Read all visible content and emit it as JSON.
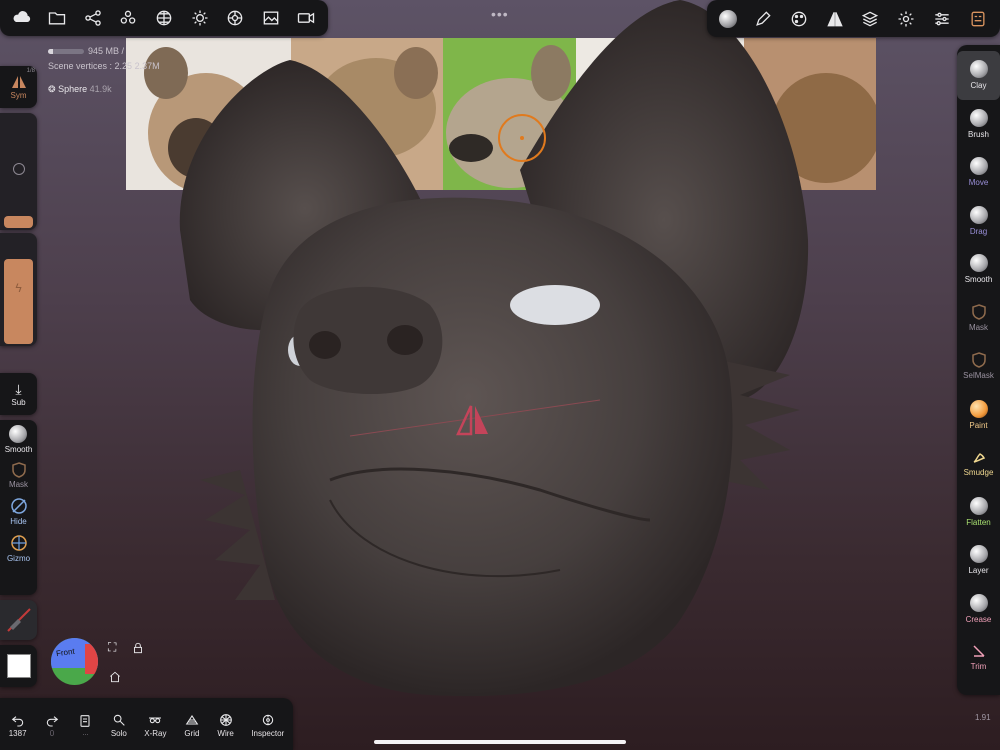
{
  "topbar_left": {
    "icons": [
      "cloud-icon",
      "folder-icon",
      "scene-tree-icon",
      "layers-tree-icon",
      "sphere-grid-icon",
      "sun-icon",
      "material-icon",
      "image-icon",
      "camera-icon"
    ]
  },
  "topbar_right": {
    "icons": [
      "brush-material-icon",
      "pen-icon",
      "palette-icon",
      "symmetry-icon",
      "stack-icon",
      "settings-icon",
      "sliders-icon",
      "app-icon"
    ]
  },
  "menu_dots": "•••",
  "stats": {
    "memory": "945 MB /",
    "memory_fraction": 0.15,
    "vertices": "Scene vertices : 2.25",
    "vertices_suffix": "2.37M"
  },
  "scene_object": {
    "name": "Sphere",
    "count": "41.9k"
  },
  "left_panel": {
    "sym_label": "Sym",
    "sym_corner": "1/8",
    "sub_label": "Sub",
    "smooth_label": "Smooth",
    "mask_label": "Mask",
    "hide_label": "Hide",
    "gizmo_label": "Gizmo",
    "radius_level": 0.1,
    "intensity_level": 0.75
  },
  "right_tools": [
    {
      "label": "Clay",
      "color": "#e8e6ea",
      "ball": "grey",
      "active": true
    },
    {
      "label": "Brush",
      "color": "#e8e6ea",
      "ball": "grey",
      "active": false
    },
    {
      "label": "Move",
      "color": "#9a8fd8",
      "ball": "grey",
      "active": false
    },
    {
      "label": "Drag",
      "color": "#9a8fd8",
      "ball": "grey",
      "active": false
    },
    {
      "label": "Smooth",
      "color": "#e8e6ea",
      "ball": "grey",
      "active": false
    },
    {
      "label": "Mask",
      "color": "#9a92a0",
      "ball": "shield",
      "active": false
    },
    {
      "label": "SelMask",
      "color": "#9a92a0",
      "ball": "shield",
      "active": false
    },
    {
      "label": "Paint",
      "color": "#f0c888",
      "ball": "orange",
      "active": false
    },
    {
      "label": "Smudge",
      "color": "#f0d890",
      "ball": "smudge",
      "active": false
    },
    {
      "label": "Flatten",
      "color": "#a8e070",
      "ball": "grey",
      "active": false
    },
    {
      "label": "Layer",
      "color": "#e8e6ea",
      "ball": "grey",
      "active": false
    },
    {
      "label": "Crease",
      "color": "#f0a0b8",
      "ball": "grey",
      "active": false
    },
    {
      "label": "Trim",
      "color": "#f0a0b8",
      "ball": "trim",
      "active": false
    }
  ],
  "bottom_bar": [
    {
      "icon": "undo-icon",
      "label": "1387",
      "sub": ""
    },
    {
      "icon": "redo-icon",
      "label": "0",
      "sub": ""
    },
    {
      "icon": "history-icon",
      "label": "",
      "sub": "..."
    },
    {
      "icon": "search-icon",
      "label": "Solo",
      "sub": ""
    },
    {
      "icon": "xray-icon",
      "label": "X-Ray",
      "sub": ""
    },
    {
      "icon": "grid-icon",
      "label": "Grid",
      "sub": ""
    },
    {
      "icon": "wire-icon",
      "label": "Wire",
      "sub": ""
    },
    {
      "icon": "inspector-icon",
      "label": "Inspector",
      "sub": ""
    }
  ],
  "view_cube": {
    "front": "Front"
  },
  "version": "1.91",
  "colors": {
    "accent": "#c8875f",
    "panel": "#161618",
    "symmetry_marker": "#c4445a",
    "cursor_ring": "#e07a1e"
  }
}
